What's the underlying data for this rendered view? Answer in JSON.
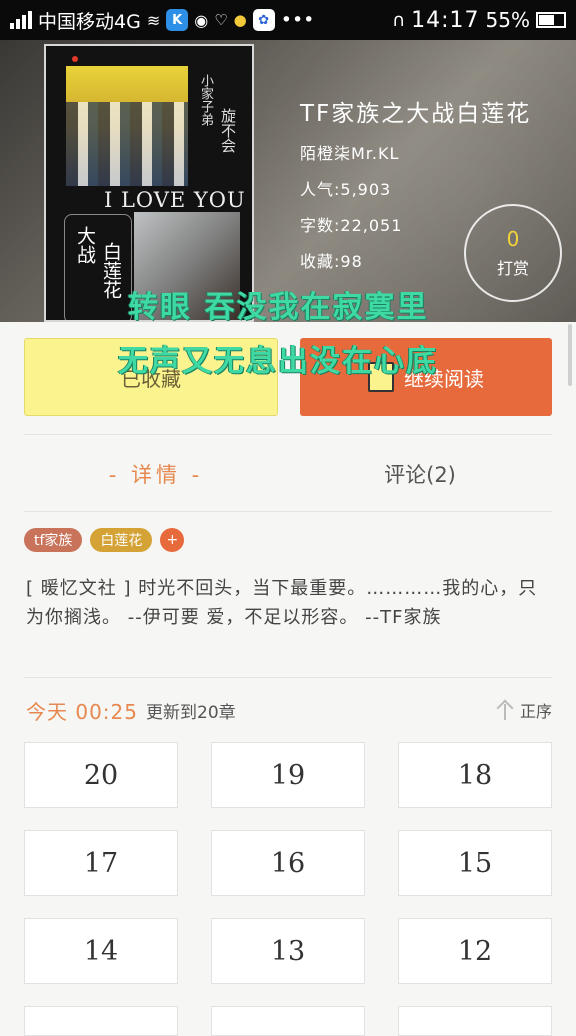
{
  "status_bar": {
    "carrier": "中国移动4G",
    "time": "14:17",
    "battery": "55%",
    "more": "•••"
  },
  "book": {
    "title": "TF家族之大战白莲花",
    "author": "陌橙柒Mr.KL",
    "popularity": "人气:5,903",
    "word_count": "字数:22,051",
    "favorites": "收藏:98",
    "reward_count": "0",
    "reward_label": "打赏",
    "cover": {
      "vertical_text_1": "小家子弟",
      "vertical_text_2": "旋不会",
      "love_text": "I LOVE YOU",
      "title_a": "大战",
      "title_b": "白莲花"
    }
  },
  "lyrics": {
    "line1": "转眼 吞没我在寂寞里",
    "line2": "无声又无息出没在心底"
  },
  "actions": {
    "favorite_label": "已收藏",
    "read_label": "继续阅读"
  },
  "tabs": {
    "details": "- 详情 -",
    "comments": "评论(2)"
  },
  "tags": [
    {
      "label": "tf家族",
      "color": "#c9735a"
    },
    {
      "label": "白莲花",
      "color": "#d4a235"
    },
    {
      "label": "+",
      "color": "#e66a3c"
    }
  ],
  "description": "[ 暖忆文社 ] 时光不回头，当下最重要。…………我的心，只为你搁浅。 --伊可要  爱，不足以形容。 --TF家族",
  "update": {
    "date": "今天 00:25",
    "text": "更新到20章",
    "sort_label": "正序"
  },
  "chapters": [
    "20",
    "19",
    "18",
    "17",
    "16",
    "15",
    "14",
    "13",
    "12"
  ],
  "colors": {
    "accent": "#e66a3c",
    "favorite_bg": "#fbf38e",
    "lyric": "#3fd9a4"
  }
}
